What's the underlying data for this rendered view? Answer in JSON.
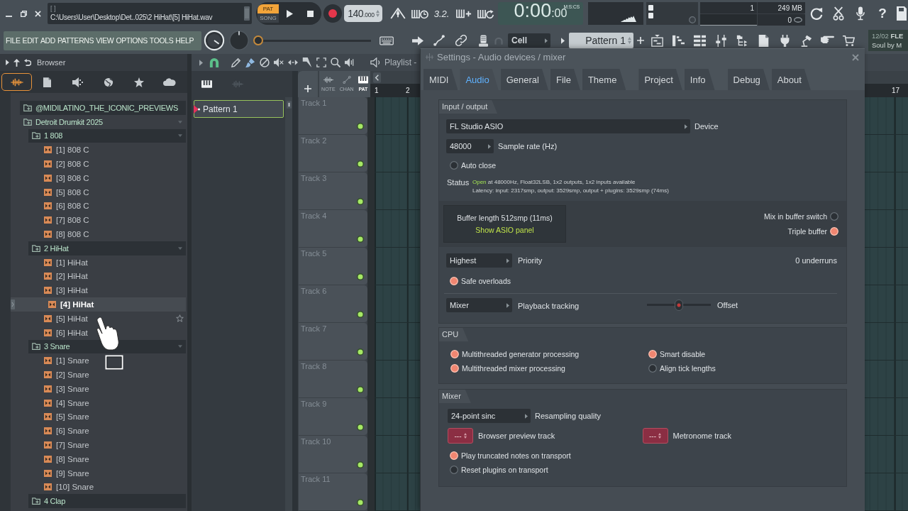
{
  "title_bar": {
    "hint_top": "[ ]",
    "hint_path": "C:\\Users\\User\\Desktop\\Det..025\\2 HiHat\\[5] HiHat.wav"
  },
  "transport": {
    "modes": [
      {
        "label": "PAT",
        "selected": true
      },
      {
        "label": "SONG",
        "selected": false
      }
    ],
    "tempo": "140",
    "tempo_decimals": ".000",
    "countdown": "3.2."
  },
  "time_display": {
    "time": "0:00",
    "centiseconds": ":00",
    "format": "M:S:CS"
  },
  "resources": {
    "polyphony": "1",
    "memory": "249 MB",
    "cpu": "0"
  },
  "help": "?",
  "menu": [
    "FILE",
    "EDIT",
    "ADD",
    "PATTERNS",
    "VIEW",
    "OPTIONS",
    "TOOLS",
    "HELP"
  ],
  "toolbar": {
    "position": {
      "level": 0
    },
    "snap": "Cell",
    "pattern": "Pattern 1"
  },
  "news": {
    "date": "12/02",
    "title": "FLE",
    "text": "Soul by M"
  },
  "browser": {
    "title": "Browser",
    "tabs": [
      {
        "selected": true
      },
      {
        "selected": false
      },
      {
        "selected": false
      },
      {
        "selected": false
      },
      {
        "selected": false
      },
      {
        "selected": false
      }
    ],
    "tree": [
      {
        "kind": "folder",
        "label": "@MIDILATINO_THE_ICONIC_PREVIEWS",
        "expanded": false
      },
      {
        "kind": "folder",
        "label": "Detroit Drumkit 2025",
        "expanded": true,
        "children": [
          {
            "kind": "folder",
            "label": "1 808",
            "expanded": true,
            "children": [
              {
                "kind": "file",
                "label": "[1] 808 C",
                "selected": false,
                "hovered": false
              },
              {
                "kind": "file",
                "label": "[2] 808 C",
                "selected": false,
                "hovered": false
              },
              {
                "kind": "file",
                "label": "[3] 808 C",
                "selected": false,
                "hovered": false
              },
              {
                "kind": "file",
                "label": "[5] 808 C",
                "selected": false,
                "hovered": false
              },
              {
                "kind": "file",
                "label": "[6] 808 C",
                "selected": false,
                "hovered": false
              },
              {
                "kind": "file",
                "label": "[7] 808 C",
                "selected": false,
                "hovered": false
              },
              {
                "kind": "file",
                "label": "[8] 808 C",
                "selected": false,
                "hovered": false
              }
            ]
          },
          {
            "kind": "folder",
            "label": "2 HiHat",
            "expanded": true,
            "children": [
              {
                "kind": "file",
                "label": "[1] HiHat",
                "selected": false,
                "hovered": false
              },
              {
                "kind": "file",
                "label": "[2] HiHat",
                "selected": false,
                "hovered": false
              },
              {
                "kind": "file",
                "label": "[3] HiHat",
                "selected": false,
                "hovered": false
              },
              {
                "kind": "file",
                "label": "[4] HiHat",
                "selected": true,
                "hovered": false
              },
              {
                "kind": "file",
                "label": "[5] HiHat",
                "selected": false,
                "hovered": true
              },
              {
                "kind": "file",
                "label": "[6] HiHat",
                "selected": false,
                "hovered": false
              }
            ]
          },
          {
            "kind": "folder",
            "label": "3 Snare",
            "expanded": true,
            "children": [
              {
                "kind": "file",
                "label": "[1] Snare",
                "selected": false,
                "hovered": false
              },
              {
                "kind": "file",
                "label": "[2] Snare",
                "selected": false,
                "hovered": false
              },
              {
                "kind": "file",
                "label": "[3] Snare",
                "selected": false,
                "hovered": false
              },
              {
                "kind": "file",
                "label": "[4] Snare",
                "selected": false,
                "hovered": false
              },
              {
                "kind": "file",
                "label": "[5] Snare",
                "selected": false,
                "hovered": false
              },
              {
                "kind": "file",
                "label": "[6] Snare",
                "selected": false,
                "hovered": false
              },
              {
                "kind": "file",
                "label": "[7] Snare",
                "selected": false,
                "hovered": false
              },
              {
                "kind": "file",
                "label": "[8] Snare",
                "selected": false,
                "hovered": false
              },
              {
                "kind": "file",
                "label": "[9] Snare",
                "selected": false,
                "hovered": false
              },
              {
                "kind": "file",
                "label": "[10] Snare",
                "selected": false,
                "hovered": false
              }
            ]
          },
          {
            "kind": "folder",
            "label": "4 Clap",
            "expanded": false
          }
        ]
      }
    ]
  },
  "playlist": {
    "title": "Playlist -",
    "picker": [
      {
        "label": "Pattern 1",
        "selected": true
      }
    ],
    "modes": [
      {
        "label": "NOTE",
        "selected": false
      },
      {
        "label": "CHAN",
        "selected": false
      },
      {
        "label": "PAT",
        "selected": true
      }
    ],
    "ruler_start": [
      "1",
      "2"
    ],
    "ruler_end": [
      "17"
    ],
    "tracks": [
      {
        "label": "Track 1",
        "enabled": true
      },
      {
        "label": "Track 2",
        "enabled": true
      },
      {
        "label": "Track 3",
        "enabled": true
      },
      {
        "label": "Track 4",
        "enabled": true
      },
      {
        "label": "Track 5",
        "enabled": true
      },
      {
        "label": "Track 6",
        "enabled": true
      },
      {
        "label": "Track 7",
        "enabled": true
      },
      {
        "label": "Track 8",
        "enabled": true
      },
      {
        "label": "Track 9",
        "enabled": true
      },
      {
        "label": "Track 10",
        "enabled": true
      },
      {
        "label": "Track 11",
        "enabled": true
      }
    ]
  },
  "settings": {
    "title": "Settings - Audio devices / mixer",
    "tab_groups": [
      [
        {
          "label": "MIDI",
          "selected": false
        },
        {
          "label": "Audio",
          "selected": true
        },
        {
          "label": "General",
          "selected": false
        },
        {
          "label": "File",
          "selected": false
        },
        {
          "label": "Theme",
          "selected": false
        }
      ],
      [
        {
          "label": "Project",
          "selected": false
        },
        {
          "label": "Info",
          "selected": false
        }
      ],
      [
        {
          "label": "Debug",
          "selected": false
        },
        {
          "label": "About",
          "selected": false
        }
      ]
    ],
    "input_output": {
      "title": "Input / output",
      "device": {
        "value": "FL Studio ASIO",
        "label": "Device"
      },
      "sample_rate": {
        "value": "48000",
        "label": "Sample rate (Hz)"
      },
      "auto_close": {
        "label": "Auto close",
        "on": false
      },
      "status": {
        "label": "Status",
        "state": "Open",
        "detail": "at 48000Hz, Float32LSB, 1x2 outputs, 1x2 inputs available",
        "latency": "Latency: input: 2317smp, output: 3529smp, output + plugins: 3529smp (74ms)"
      },
      "buffer": {
        "length": "Buffer length 512smp (11ms)",
        "link": "Show ASIO panel"
      },
      "buffer_options": [
        {
          "label": "Mix in buffer switch",
          "on": false
        },
        {
          "label": "Triple buffer",
          "on": true
        }
      ],
      "priority": {
        "value": "Highest",
        "label": "Priority",
        "underruns": "0 underruns"
      },
      "safe_overloads": {
        "label": "Safe overloads",
        "on": true
      },
      "tracking": {
        "value": "Mixer",
        "label": "Playback tracking",
        "offset": {
          "label": "Offset",
          "level": 0.5
        }
      }
    },
    "cpu": {
      "title": "CPU",
      "options": [
        {
          "label": "Multithreaded generator processing",
          "on": true
        },
        {
          "label": "Smart disable",
          "on": true
        },
        {
          "label": "Multithreaded mixer processing",
          "on": true
        },
        {
          "label": "Align tick lengths",
          "on": false
        }
      ]
    },
    "mixer": {
      "title": "Mixer",
      "resampling": {
        "value": "24-point sinc",
        "label": "Resampling quality"
      },
      "tracks": [
        {
          "value": "---",
          "label": "Browser preview track"
        },
        {
          "value": "---",
          "label": "Metronome track"
        }
      ],
      "options": [
        {
          "label": "Play truncated notes on transport",
          "on": true
        },
        {
          "label": "Reset plugins on transport",
          "on": false
        }
      ]
    }
  }
}
